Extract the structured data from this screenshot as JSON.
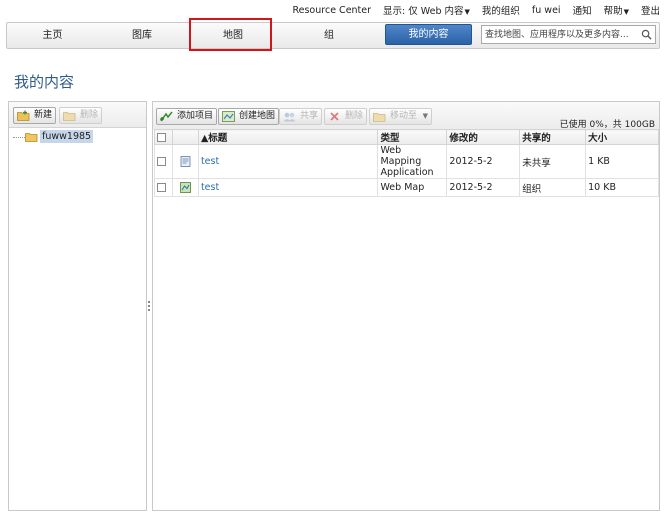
{
  "topbar": {
    "resource_center": "Resource Center",
    "show_only": "显示: 仅 Web 内容",
    "my_org": "我的组织",
    "user": "fu wei",
    "notifications": "通知",
    "help": "帮助",
    "logout": "登出"
  },
  "nav": {
    "home": "主页",
    "gallery": "图库",
    "map": "地图",
    "groups": "组",
    "my_content": "我的内容",
    "search_placeholder": "查找地图、应用程序以及更多内容..."
  },
  "page": {
    "title": "我的内容"
  },
  "left_panel": {
    "new_label": "新建",
    "delete_label": "删除",
    "folder": "fuww1985"
  },
  "right_panel": {
    "toolbar": {
      "add_item": "添加项目",
      "create_map": "创建地图",
      "share": "共享",
      "delete": "删除",
      "move_to": "移动至"
    },
    "usage": "已使用 0%，共 100GB",
    "columns": {
      "title": "▲标题",
      "type": "类型",
      "modified": "修改的",
      "shared": "共享的",
      "size": "大小"
    },
    "rows": [
      {
        "title": "test",
        "type": "Web Mapping Application",
        "modified": "2012-5-2",
        "shared": "未共享",
        "size": "1 KB",
        "icon": "web-app-icon"
      },
      {
        "title": "test",
        "type": "Web Map",
        "modified": "2012-5-2",
        "shared": "组织",
        "size": "10 KB",
        "icon": "web-map-icon"
      }
    ]
  }
}
